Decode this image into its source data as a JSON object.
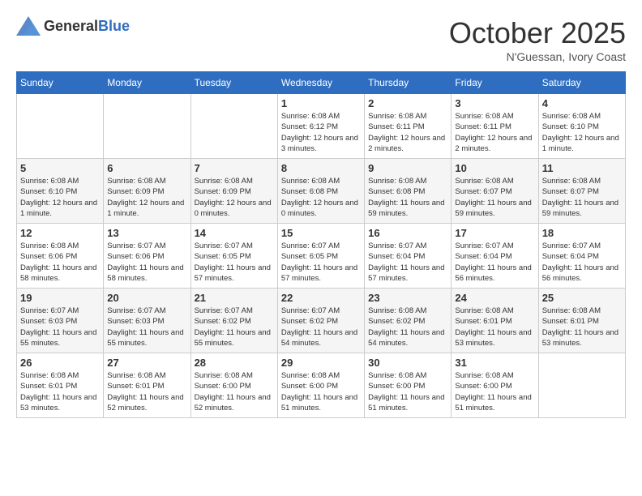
{
  "header": {
    "logo_general": "General",
    "logo_blue": "Blue",
    "month": "October 2025",
    "location": "N'Guessan, Ivory Coast"
  },
  "days_of_week": [
    "Sunday",
    "Monday",
    "Tuesday",
    "Wednesday",
    "Thursday",
    "Friday",
    "Saturday"
  ],
  "weeks": [
    [
      {
        "day": "",
        "info": ""
      },
      {
        "day": "",
        "info": ""
      },
      {
        "day": "",
        "info": ""
      },
      {
        "day": "1",
        "info": "Sunrise: 6:08 AM\nSunset: 6:12 PM\nDaylight: 12 hours\nand 3 minutes."
      },
      {
        "day": "2",
        "info": "Sunrise: 6:08 AM\nSunset: 6:11 PM\nDaylight: 12 hours\nand 2 minutes."
      },
      {
        "day": "3",
        "info": "Sunrise: 6:08 AM\nSunset: 6:11 PM\nDaylight: 12 hours\nand 2 minutes."
      },
      {
        "day": "4",
        "info": "Sunrise: 6:08 AM\nSunset: 6:10 PM\nDaylight: 12 hours\nand 1 minute."
      }
    ],
    [
      {
        "day": "5",
        "info": "Sunrise: 6:08 AM\nSunset: 6:10 PM\nDaylight: 12 hours\nand 1 minute."
      },
      {
        "day": "6",
        "info": "Sunrise: 6:08 AM\nSunset: 6:09 PM\nDaylight: 12 hours\nand 1 minute."
      },
      {
        "day": "7",
        "info": "Sunrise: 6:08 AM\nSunset: 6:09 PM\nDaylight: 12 hours\nand 0 minutes."
      },
      {
        "day": "8",
        "info": "Sunrise: 6:08 AM\nSunset: 6:08 PM\nDaylight: 12 hours\nand 0 minutes."
      },
      {
        "day": "9",
        "info": "Sunrise: 6:08 AM\nSunset: 6:08 PM\nDaylight: 11 hours\nand 59 minutes."
      },
      {
        "day": "10",
        "info": "Sunrise: 6:08 AM\nSunset: 6:07 PM\nDaylight: 11 hours\nand 59 minutes."
      },
      {
        "day": "11",
        "info": "Sunrise: 6:08 AM\nSunset: 6:07 PM\nDaylight: 11 hours\nand 59 minutes."
      }
    ],
    [
      {
        "day": "12",
        "info": "Sunrise: 6:08 AM\nSunset: 6:06 PM\nDaylight: 11 hours\nand 58 minutes."
      },
      {
        "day": "13",
        "info": "Sunrise: 6:07 AM\nSunset: 6:06 PM\nDaylight: 11 hours\nand 58 minutes."
      },
      {
        "day": "14",
        "info": "Sunrise: 6:07 AM\nSunset: 6:05 PM\nDaylight: 11 hours\nand 57 minutes."
      },
      {
        "day": "15",
        "info": "Sunrise: 6:07 AM\nSunset: 6:05 PM\nDaylight: 11 hours\nand 57 minutes."
      },
      {
        "day": "16",
        "info": "Sunrise: 6:07 AM\nSunset: 6:04 PM\nDaylight: 11 hours\nand 57 minutes."
      },
      {
        "day": "17",
        "info": "Sunrise: 6:07 AM\nSunset: 6:04 PM\nDaylight: 11 hours\nand 56 minutes."
      },
      {
        "day": "18",
        "info": "Sunrise: 6:07 AM\nSunset: 6:04 PM\nDaylight: 11 hours\nand 56 minutes."
      }
    ],
    [
      {
        "day": "19",
        "info": "Sunrise: 6:07 AM\nSunset: 6:03 PM\nDaylight: 11 hours\nand 55 minutes."
      },
      {
        "day": "20",
        "info": "Sunrise: 6:07 AM\nSunset: 6:03 PM\nDaylight: 11 hours\nand 55 minutes."
      },
      {
        "day": "21",
        "info": "Sunrise: 6:07 AM\nSunset: 6:02 PM\nDaylight: 11 hours\nand 55 minutes."
      },
      {
        "day": "22",
        "info": "Sunrise: 6:07 AM\nSunset: 6:02 PM\nDaylight: 11 hours\nand 54 minutes."
      },
      {
        "day": "23",
        "info": "Sunrise: 6:08 AM\nSunset: 6:02 PM\nDaylight: 11 hours\nand 54 minutes."
      },
      {
        "day": "24",
        "info": "Sunrise: 6:08 AM\nSunset: 6:01 PM\nDaylight: 11 hours\nand 53 minutes."
      },
      {
        "day": "25",
        "info": "Sunrise: 6:08 AM\nSunset: 6:01 PM\nDaylight: 11 hours\nand 53 minutes."
      }
    ],
    [
      {
        "day": "26",
        "info": "Sunrise: 6:08 AM\nSunset: 6:01 PM\nDaylight: 11 hours\nand 53 minutes."
      },
      {
        "day": "27",
        "info": "Sunrise: 6:08 AM\nSunset: 6:01 PM\nDaylight: 11 hours\nand 52 minutes."
      },
      {
        "day": "28",
        "info": "Sunrise: 6:08 AM\nSunset: 6:00 PM\nDaylight: 11 hours\nand 52 minutes."
      },
      {
        "day": "29",
        "info": "Sunrise: 6:08 AM\nSunset: 6:00 PM\nDaylight: 11 hours\nand 51 minutes."
      },
      {
        "day": "30",
        "info": "Sunrise: 6:08 AM\nSunset: 6:00 PM\nDaylight: 11 hours\nand 51 minutes."
      },
      {
        "day": "31",
        "info": "Sunrise: 6:08 AM\nSunset: 6:00 PM\nDaylight: 11 hours\nand 51 minutes."
      },
      {
        "day": "",
        "info": ""
      }
    ]
  ]
}
